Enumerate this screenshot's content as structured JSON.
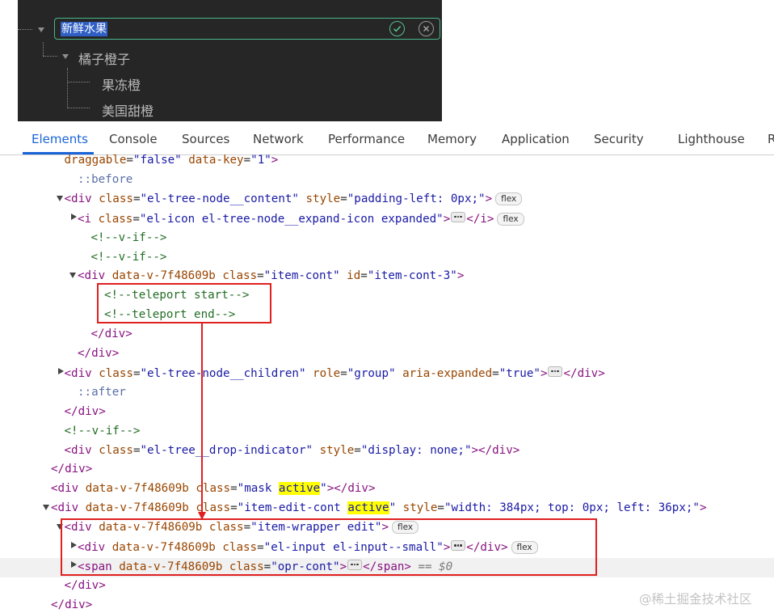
{
  "preview": {
    "edit_value": "新鲜水果",
    "child_label": "橘子橙子",
    "grandchildren": [
      "果冻橙",
      "美国甜橙"
    ]
  },
  "tabs": [
    "Elements",
    "Console",
    "Sources",
    "Network",
    "Performance",
    "Memory",
    "Application",
    "Security",
    "Lighthouse"
  ],
  "tab_overflow": "R",
  "elements_lines": [
    {
      "indent": 1,
      "twisty": "none",
      "parts": [
        [
          "an",
          "draggable"
        ],
        [
          "pu",
          "="
        ],
        [
          "av",
          "\"false\""
        ],
        [
          "pu",
          " "
        ],
        [
          "an",
          "data-key"
        ],
        [
          "pu",
          "="
        ],
        [
          "av",
          "\"1\""
        ],
        [
          "tag",
          ">"
        ]
      ]
    },
    {
      "indent": 2,
      "twisty": "none",
      "parts": [
        [
          "pse",
          "::before"
        ]
      ]
    },
    {
      "indent": 1,
      "twisty": "open",
      "parts": [
        [
          "tag",
          "<div "
        ],
        [
          "an",
          "class"
        ],
        [
          "pu",
          "="
        ],
        [
          "av",
          "\"el-tree-node__content\""
        ],
        [
          "pu",
          " "
        ],
        [
          "an",
          "style"
        ],
        [
          "pu",
          "="
        ],
        [
          "av",
          "\"padding-left: 0px;\""
        ],
        [
          "tag",
          ">"
        ],
        [
          "badge",
          "flex"
        ]
      ]
    },
    {
      "indent": 2,
      "twisty": "closed",
      "parts": [
        [
          "tag",
          "<i "
        ],
        [
          "an",
          "class"
        ],
        [
          "pu",
          "="
        ],
        [
          "av",
          "\"el-icon el-tree-node__expand-icon expanded\""
        ],
        [
          "tag",
          ">"
        ],
        [
          "ellipsis",
          ""
        ],
        [
          "tag",
          "</i>"
        ],
        [
          "badge",
          "flex"
        ]
      ]
    },
    {
      "indent": 3,
      "twisty": "none",
      "parts": [
        [
          "cm",
          "<!--v-if-->"
        ]
      ]
    },
    {
      "indent": 3,
      "twisty": "none",
      "parts": [
        [
          "cm",
          "<!--v-if-->"
        ]
      ]
    },
    {
      "indent": 2,
      "twisty": "open",
      "parts": [
        [
          "tag",
          "<div "
        ],
        [
          "an",
          "data-v-7f48609b"
        ],
        [
          "pu",
          " "
        ],
        [
          "an",
          "class"
        ],
        [
          "pu",
          "="
        ],
        [
          "av",
          "\"item-cont\""
        ],
        [
          "pu",
          " "
        ],
        [
          "an",
          "id"
        ],
        [
          "pu",
          "="
        ],
        [
          "av",
          "\"item-cont-3\""
        ],
        [
          "tag",
          ">"
        ]
      ]
    },
    {
      "indent": 4,
      "twisty": "none",
      "parts": [
        [
          "cm",
          "<!--teleport start-->"
        ]
      ]
    },
    {
      "indent": 4,
      "twisty": "none",
      "parts": [
        [
          "cm",
          "<!--teleport end-->"
        ]
      ]
    },
    {
      "indent": 3,
      "twisty": "none",
      "parts": [
        [
          "tag",
          "</div>"
        ]
      ]
    },
    {
      "indent": 2,
      "twisty": "none",
      "parts": [
        [
          "tag",
          "</div>"
        ]
      ]
    },
    {
      "indent": 1,
      "twisty": "closed",
      "parts": [
        [
          "tag",
          "<div "
        ],
        [
          "an",
          "class"
        ],
        [
          "pu",
          "="
        ],
        [
          "av",
          "\"el-tree-node__children\""
        ],
        [
          "pu",
          " "
        ],
        [
          "an",
          "role"
        ],
        [
          "pu",
          "="
        ],
        [
          "av",
          "\"group\""
        ],
        [
          "pu",
          " "
        ],
        [
          "an",
          "aria-expanded"
        ],
        [
          "pu",
          "="
        ],
        [
          "av",
          "\"true\""
        ],
        [
          "tag",
          ">"
        ],
        [
          "ellipsis",
          ""
        ],
        [
          "tag",
          "</div>"
        ]
      ]
    },
    {
      "indent": 2,
      "twisty": "none",
      "parts": [
        [
          "pse",
          "::after"
        ]
      ]
    },
    {
      "indent": 1,
      "twisty": "none",
      "parts": [
        [
          "tag",
          "</div>"
        ]
      ]
    },
    {
      "indent": 1,
      "twisty": "none",
      "parts": [
        [
          "cm",
          "<!--v-if-->"
        ]
      ]
    },
    {
      "indent": 1,
      "twisty": "none",
      "parts": [
        [
          "tag",
          "<div "
        ],
        [
          "an",
          "class"
        ],
        [
          "pu",
          "="
        ],
        [
          "av",
          "\"el-tree__drop-indicator\""
        ],
        [
          "pu",
          " "
        ],
        [
          "an",
          "style"
        ],
        [
          "pu",
          "="
        ],
        [
          "av",
          "\"display: none;\""
        ],
        [
          "tag",
          "></div>"
        ]
      ]
    },
    {
      "indent": 0,
      "twisty": "none",
      "parts": [
        [
          "tag",
          "</div>"
        ]
      ]
    },
    {
      "indent": 0,
      "twisty": "none",
      "parts": [
        [
          "tag",
          "<div "
        ],
        [
          "an",
          "data-v-7f48609b"
        ],
        [
          "pu",
          " "
        ],
        [
          "an",
          "class"
        ],
        [
          "pu",
          "="
        ],
        [
          "av",
          "\"mask "
        ],
        [
          "hl",
          "active"
        ],
        [
          "av",
          "\""
        ],
        [
          "tag",
          "></div>"
        ]
      ]
    },
    {
      "indent": 0,
      "twisty": "open",
      "parts": [
        [
          "tag",
          "<div "
        ],
        [
          "an",
          "data-v-7f48609b"
        ],
        [
          "pu",
          " "
        ],
        [
          "an",
          "class"
        ],
        [
          "pu",
          "="
        ],
        [
          "av",
          "\"item-edit-cont "
        ],
        [
          "hl",
          "active"
        ],
        [
          "av",
          "\""
        ],
        [
          "pu",
          " "
        ],
        [
          "an",
          "style"
        ],
        [
          "pu",
          "="
        ],
        [
          "av",
          "\"width: 384px; top: 0px; left: 36px;\""
        ],
        [
          "tag",
          ">"
        ]
      ]
    },
    {
      "indent": 1,
      "twisty": "open",
      "parts": [
        [
          "tag",
          "<div "
        ],
        [
          "an",
          "data-v-7f48609b"
        ],
        [
          "pu",
          " "
        ],
        [
          "an",
          "class"
        ],
        [
          "pu",
          "="
        ],
        [
          "av",
          "\"item-wrapper edit\""
        ],
        [
          "tag",
          ">"
        ],
        [
          "badge",
          "flex"
        ]
      ]
    },
    {
      "indent": 2,
      "twisty": "closed",
      "parts": [
        [
          "tag",
          "<div "
        ],
        [
          "an",
          "data-v-7f48609b"
        ],
        [
          "pu",
          " "
        ],
        [
          "an",
          "class"
        ],
        [
          "pu",
          "="
        ],
        [
          "av",
          "\"el-input el-input--small\""
        ],
        [
          "tag",
          ">"
        ],
        [
          "ellipsis",
          ""
        ],
        [
          "tag",
          "</div>"
        ],
        [
          "badge",
          "flex"
        ]
      ]
    },
    {
      "indent": 2,
      "twisty": "closed",
      "selected": true,
      "parts": [
        [
          "tag",
          "<span "
        ],
        [
          "an",
          "data-v-7f48609b"
        ],
        [
          "pu",
          " "
        ],
        [
          "an",
          "class"
        ],
        [
          "pu",
          "="
        ],
        [
          "av",
          "\"opr-cont\""
        ],
        [
          "tag",
          ">"
        ],
        [
          "ellipsis",
          ""
        ],
        [
          "tag",
          "</span>"
        ],
        [
          "muted",
          " == $0"
        ]
      ]
    },
    {
      "indent": 1,
      "twisty": "none",
      "parts": [
        [
          "tag",
          "</div>"
        ]
      ]
    },
    {
      "indent": 0,
      "twisty": "none",
      "parts": [
        [
          "tag",
          "</div>"
        ]
      ]
    }
  ],
  "watermark": "@稀土掘金技术社区",
  "colors": {
    "accent": "#1a63d6",
    "annotation": "#e02020",
    "highlight": "#ffff00"
  }
}
